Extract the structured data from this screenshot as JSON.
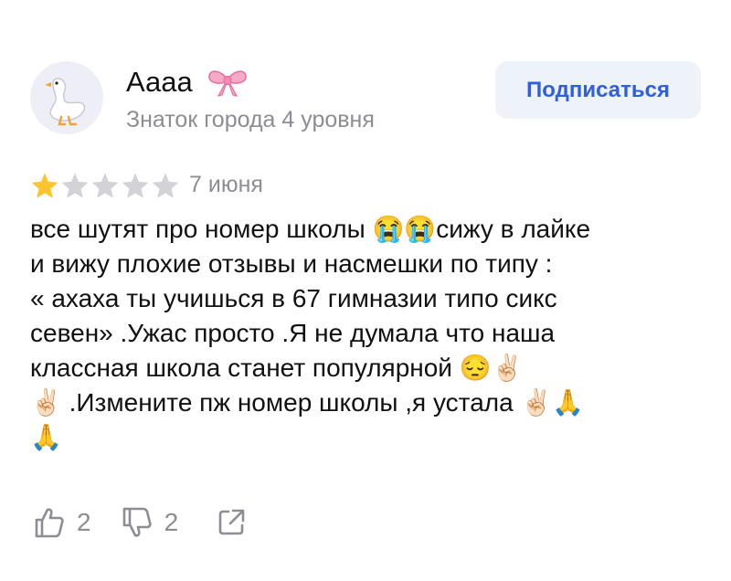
{
  "user": {
    "name": "Аааа",
    "level": "Знаток города 4 уровня",
    "avatar_icon": "goose-icon",
    "badge_icon": "bow-emoji"
  },
  "subscribe_label": "Подписаться",
  "review": {
    "rating": 1,
    "max_rating": 5,
    "date": "7 июня",
    "lines": [
      "все шутят про номер школы 😭😭сижу в лайке",
      "и вижу плохие отзывы и насмешки по типу :",
      "« ахаха ты учишься в 67 гимназии типо сикс",
      "севен» .Ужас просто .Я не думала что наша",
      "классная школа станет популярной 😔✌🏻",
      "✌🏻 .Измените пж номер школы ,я устала ✌🏻🙏",
      "🙏"
    ]
  },
  "actions": {
    "likes": "2",
    "dislikes": "2",
    "share_icon": "share-icon"
  },
  "colors": {
    "accent": "#2f5fdc",
    "button_bg": "#eef2f9",
    "star_active": "#fdc52d",
    "star_inactive": "#d2d2d7",
    "muted": "#8d8d93"
  }
}
